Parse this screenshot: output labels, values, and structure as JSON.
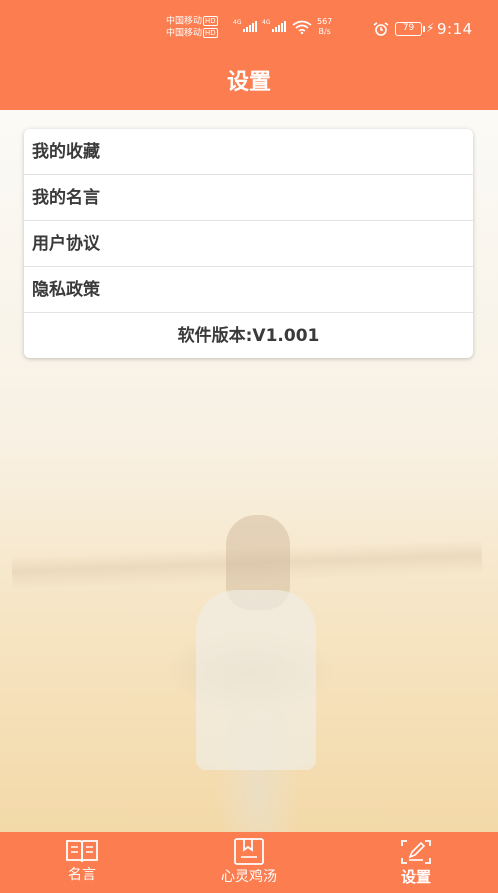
{
  "status_bar": {
    "carrier_1": "中国移动",
    "carrier_2": "中国移动",
    "hd_badge": "HD",
    "network_type": "4G",
    "net_speed_value": "567",
    "net_speed_unit": "B/s",
    "battery_level": "79",
    "time": "9:14"
  },
  "header": {
    "title": "设置"
  },
  "settings": {
    "items": [
      {
        "label": "我的收藏"
      },
      {
        "label": "我的名言"
      },
      {
        "label": "用户协议"
      },
      {
        "label": "隐私政策"
      }
    ],
    "version_text": "软件版本:V1.001"
  },
  "tabbar": {
    "tabs": [
      {
        "label": "名言",
        "icon": "book-icon"
      },
      {
        "label": "心灵鸡汤",
        "icon": "bookmark-page-icon"
      },
      {
        "label": "设置",
        "icon": "edit-settings-icon"
      }
    ],
    "active_index": 2
  },
  "colors": {
    "brand": "#fb7d50",
    "card_text": "#3a3a3a"
  }
}
